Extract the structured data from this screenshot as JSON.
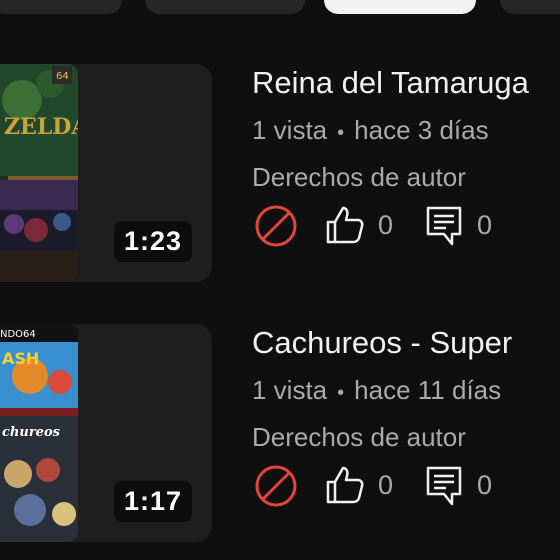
{
  "videos": [
    {
      "title": "Reina del Tamaruga",
      "views": "1 vista",
      "separator": "•",
      "age": "hace 3 días",
      "status": "Derechos de autor",
      "duration": "1:23",
      "likes": "0",
      "comments": "0",
      "thumb_text": "ZELDA"
    },
    {
      "title": "Cachureos - Super",
      "views": "1 vista",
      "separator": "•",
      "age": "hace 11 días",
      "status": "Derechos de autor",
      "duration": "1:17",
      "likes": "0",
      "comments": "0",
      "thumb_text_top": "NDO64",
      "thumb_text_mid": "ASH",
      "thumb_text_bottom": "chureos"
    }
  ],
  "icons": {
    "restriction": "no-entry-icon",
    "like": "thumbs-up-icon",
    "comment": "comment-icon"
  },
  "colors": {
    "background": "#0f0f0f",
    "card": "#1e1e1e",
    "restriction": "#e2463a",
    "secondary_text": "#aaaaaa"
  }
}
